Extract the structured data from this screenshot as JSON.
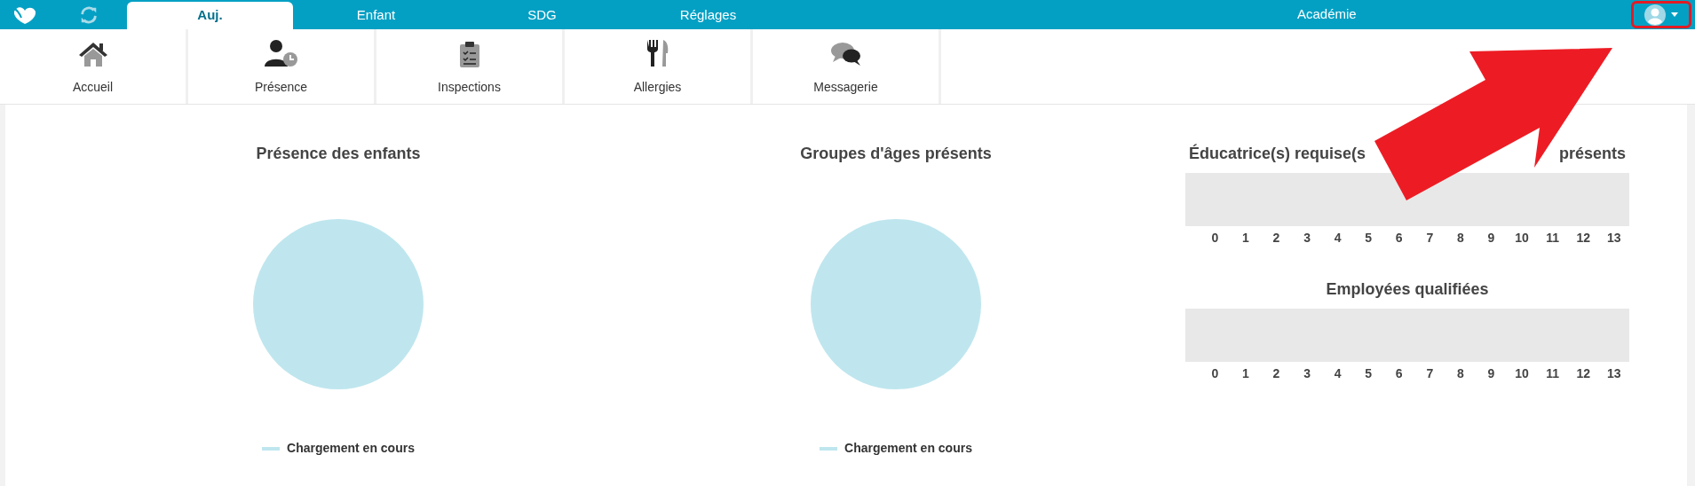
{
  "top_bar": {
    "tabs": [
      {
        "label": "Auj.",
        "selected": true
      },
      {
        "label": "Enfant",
        "selected": false
      },
      {
        "label": "SDG",
        "selected": false
      },
      {
        "label": "Réglages",
        "selected": false
      }
    ],
    "organization": "Académie",
    "user_menu": {
      "highlighted": true
    }
  },
  "nav": [
    {
      "label": "Accueil"
    },
    {
      "label": "Présence"
    },
    {
      "label": "Inspections"
    },
    {
      "label": "Allergies"
    },
    {
      "label": "Messagerie"
    }
  ],
  "pies": [
    {
      "title": "Présence des enfants",
      "legend": [
        "Chargement en cours"
      ]
    },
    {
      "title": "Groupes d'âges présents",
      "legend": [
        "Chargement en cours"
      ]
    }
  ],
  "bars": [
    {
      "title_parts": [
        "Éducatrice(s) requise(s",
        "présents"
      ],
      "axis_ticks": [
        "0",
        "1",
        "2",
        "3",
        "4",
        "5",
        "6",
        "7",
        "8",
        "9",
        "10",
        "11",
        "12",
        "13"
      ]
    },
    {
      "title_parts": [
        "Employées qualifiées"
      ],
      "axis_ticks": [
        "0",
        "1",
        "2",
        "3",
        "4",
        "5",
        "6",
        "7",
        "8",
        "9",
        "10",
        "11",
        "12",
        "13"
      ]
    }
  ],
  "annotation": {
    "kind": "arrow",
    "color": "#ed1c24"
  }
}
